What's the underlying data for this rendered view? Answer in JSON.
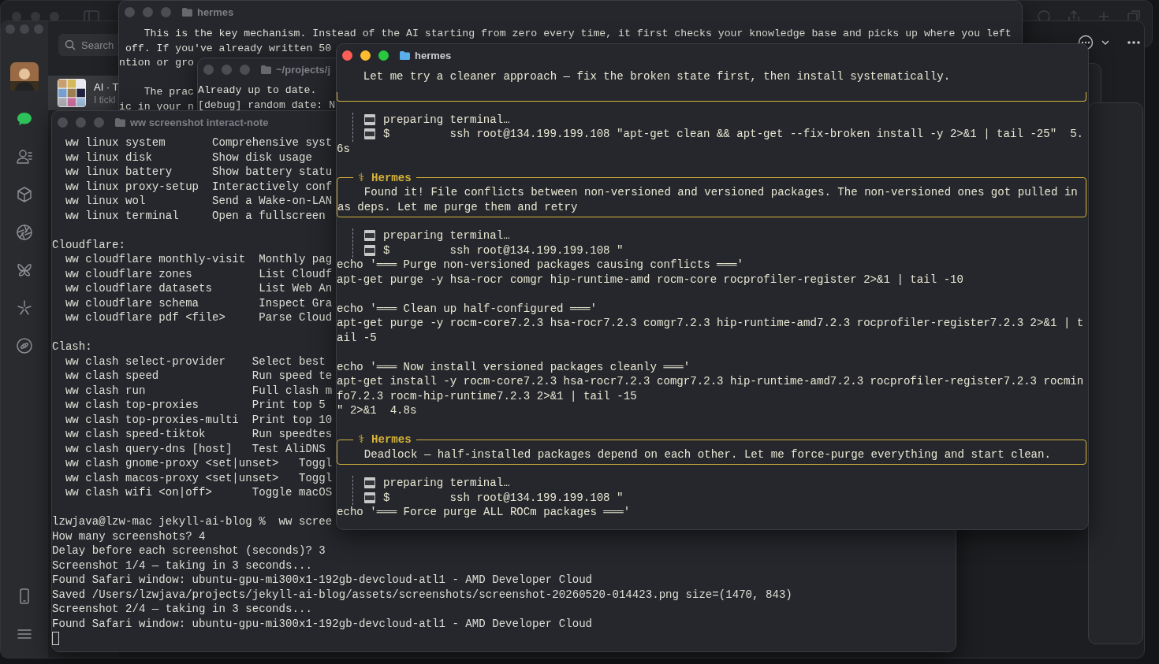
{
  "chat_app": {
    "sidebar": {
      "items": [
        {
          "kind": "chat",
          "selected": true
        },
        {
          "kind": "contacts",
          "selected": false
        },
        {
          "kind": "cube",
          "selected": false
        },
        {
          "kind": "aperture",
          "selected": false
        },
        {
          "kind": "butterfly",
          "selected": false
        },
        {
          "kind": "sparkle",
          "selected": false
        },
        {
          "kind": "link",
          "selected": false
        }
      ],
      "bottom_items": [
        {
          "kind": "phone",
          "selected": false
        },
        {
          "kind": "menu",
          "selected": false
        }
      ]
    },
    "search": {
      "placeholder": "Search"
    },
    "chat": {
      "name": "AI · T",
      "preview": "I tickl",
      "selected": true
    }
  },
  "windows": [
    {
      "title": "hermes",
      "active": false,
      "blocks": [
        [
          "    This is the key mechanism. Instead of the AI starting from zero every time, it first checks your knowledge base and picks up where you left",
          " off. If you've already written 50",
          "ntion or gro"
        ],
        [
          "    The prac",
          "ic in your n"
        ]
      ]
    },
    {
      "title": "~/projects/j",
      "active": false,
      "blocks": [
        [
          "Already up to date.",
          "[debug] random date: N"
        ]
      ]
    },
    {
      "title": "ww screenshot interact-note",
      "active": false,
      "cursor": true,
      "blocks": [
        [
          "  ww linux system       Comprehensive syst",
          "  ww linux disk         Show disk usage",
          "  ww linux battery      Show battery statu",
          "  ww linux proxy-setup  Interactively conf",
          "  ww linux wol          Send a Wake-on-LAN",
          "  ww linux terminal     Open a fullscreen"
        ],
        [
          "Cloudflare:",
          "  ww cloudflare monthly-visit  Monthly pag",
          "  ww cloudflare zones          List Cloudf",
          "  ww cloudflare datasets       List Web An",
          "  ww cloudflare schema         Inspect Gra",
          "  ww cloudflare pdf <file>     Parse Cloud"
        ],
        [
          "Clash:",
          "  ww clash select-provider    Select best",
          "  ww clash speed              Run speed te",
          "  ww clash run                Full clash m",
          "  ww clash top-proxies        Print top 5",
          "  ww clash top-proxies-multi  Print top 10",
          "  ww clash speed-tiktok       Run speedtes",
          "  ww clash query-dns [host]   Test AliDNS",
          "  ww clash gnome-proxy <set|unset>   Toggl",
          "  ww clash macos-proxy <set|unset>   Toggl",
          "  ww clash wifi <on|off>      Toggle macOS"
        ],
        [
          "lzwjava@lzw-mac jekyll-ai-blog %  ww scree",
          "How many screenshots? 4",
          "Delay before each screenshot (seconds)? 3",
          "Screenshot 1/4 — taking in 3 seconds...",
          "Found Safari window: ubuntu-gpu-mi300x1-192gb-devcloud-atl1 - AMD Developer Cloud",
          "Saved /Users/lzwjava/projects/jekyll-ai-blog/assets/screenshots/screenshot-20260520-014423.png size=(1470, 843)",
          "Screenshot 2/4 — taking in 3 seconds...",
          "Found Safari window: ubuntu-gpu-mi300x1-192gb-devcloud-atl1 - AMD Developer Cloud"
        ]
      ]
    },
    {
      "title": "hermes",
      "active": true,
      "items": [
        {
          "kind": "message",
          "lines": [
            "    Let me try a cleaner approach — fix the broken state first, then install systematically."
          ]
        },
        {
          "kind": "tool",
          "status": "preparing terminal…",
          "command": "$         ssh root@134.199.199.108 \"apt-get clean && apt-get --fix-broken install -y 2>&1 | tail -25\"  5.",
          "output": [
            [
              "6s"
            ]
          ]
        },
        {
          "kind": "message",
          "symbol": "⚕",
          "label": "Hermes",
          "lines": [
            "    Found it! File conflicts between non-versioned and versioned packages. The non-versioned ones got pulled in",
            "as deps. Let me purge them and retry"
          ]
        },
        {
          "kind": "tool",
          "status": "preparing terminal…",
          "command": "$         ssh root@134.199.199.108 \"",
          "output": [
            [
              "echo '═══ Purge non-versioned packages causing conflicts ═══'",
              "apt-get purge -y hsa-rocr comgr hip-runtime-amd rocm-core rocprofiler-register 2>&1 | tail -10"
            ],
            [
              "echo '═══ Clean up half-configured ═══'",
              "apt-get purge -y rocm-core7.2.3 hsa-rocr7.2.3 comgr7.2.3 hip-runtime-amd7.2.3 rocprofiler-register7.2.3 2>&1 | t",
              "ail -5"
            ],
            [
              "echo '═══ Now install versioned packages cleanly ═══'",
              "apt-get install -y rocm-core7.2.3 hsa-rocr7.2.3 comgr7.2.3 hip-runtime-amd7.2.3 rocprofiler-register7.2.3 rocmin",
              "fo7.2.3 rocm-hip-runtime7.2.3 2>&1 | tail -15",
              "\" 2>&1  4.8s"
            ]
          ]
        },
        {
          "kind": "message",
          "symbol": "⚕",
          "label": "Hermes",
          "lines": [
            "    Deadlock — half-installed packages depend on each other. Let me force-purge everything and start clean."
          ]
        },
        {
          "kind": "tool",
          "status": "preparing terminal…",
          "command": "$         ssh root@134.199.199.108 \"",
          "output": [
            [
              "echo '═══ Force purge ALL ROCm packages ═══'"
            ]
          ]
        }
      ]
    }
  ]
}
